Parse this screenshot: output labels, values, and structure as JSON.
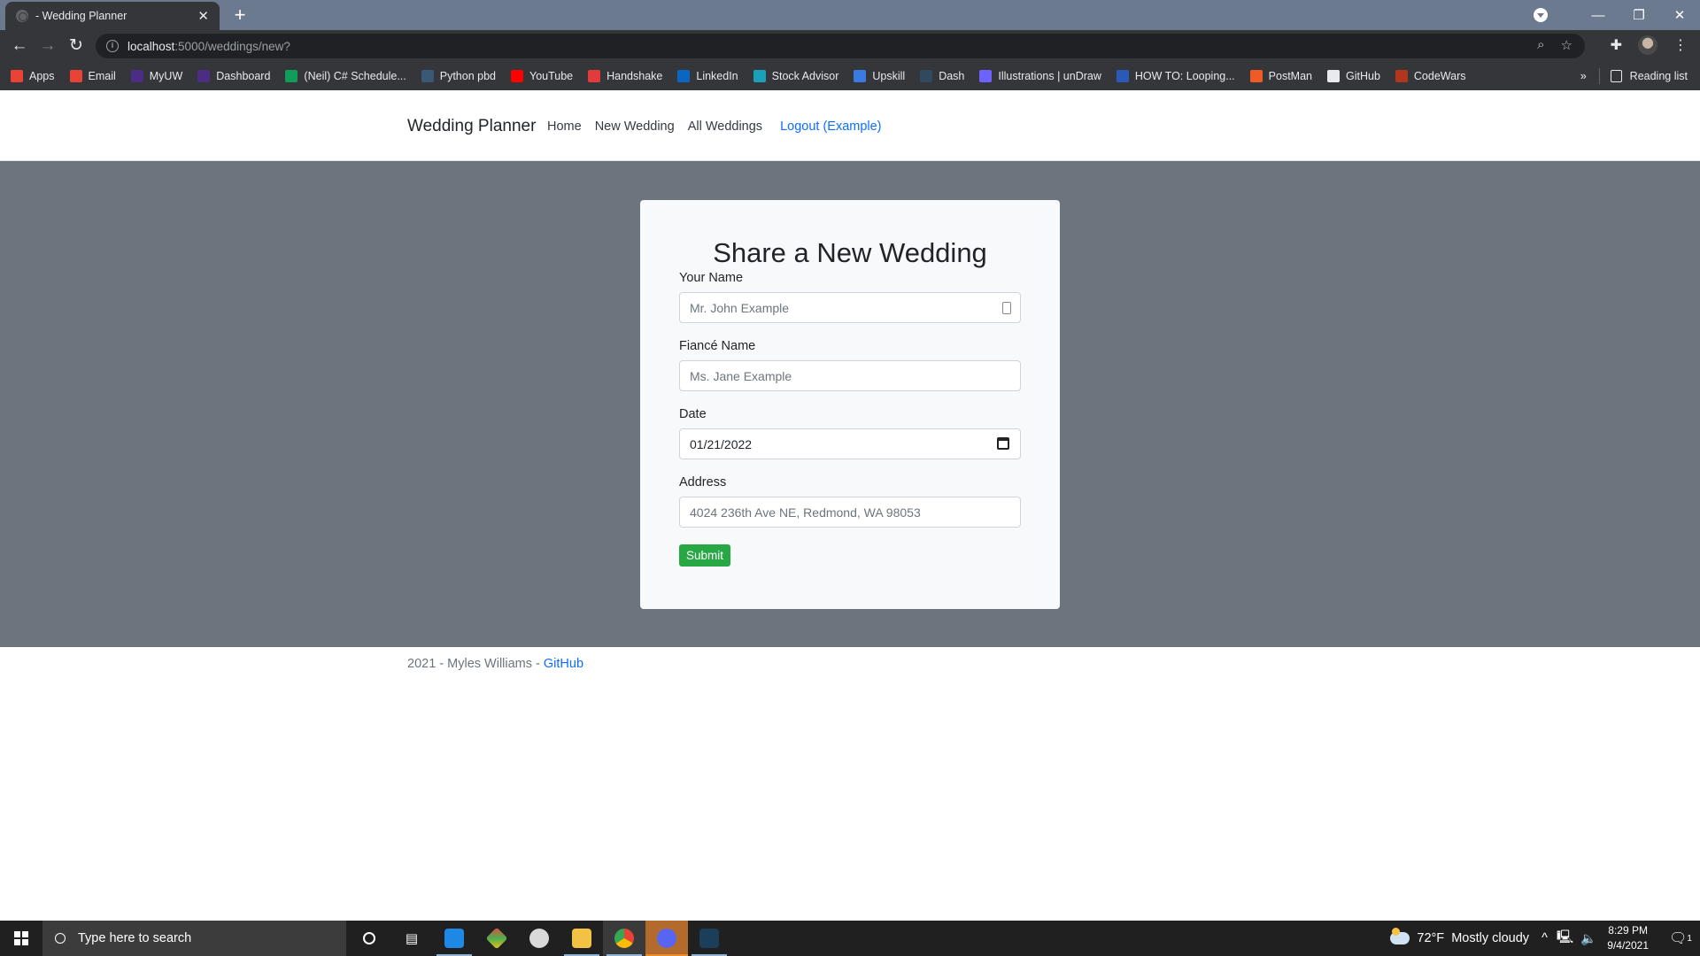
{
  "browser": {
    "tab_title": "- Wedding Planner",
    "url_host": "localhost",
    "url_path": ":5000/weddings/new?",
    "bookmarks": [
      {
        "label": "Apps",
        "icon": "apps-grid-icon",
        "color": "#ea4335"
      },
      {
        "label": "Email",
        "icon": "gmail-icon",
        "color": "#ea4335"
      },
      {
        "label": "MyUW",
        "icon": "uw-icon",
        "color": "#4b2e83"
      },
      {
        "label": "Dashboard",
        "icon": "uw-dashboard-icon",
        "color": "#4b2e83"
      },
      {
        "label": "(Neil) C# Schedule...",
        "icon": "sheets-icon",
        "color": "#0f9d58"
      },
      {
        "label": "Python pbd",
        "icon": "python-icon",
        "color": "#3b5875"
      },
      {
        "label": "YouTube",
        "icon": "youtube-icon",
        "color": "#ff0000"
      },
      {
        "label": "Handshake",
        "icon": "handshake-icon",
        "color": "#e23b3b"
      },
      {
        "label": "LinkedIn",
        "icon": "linkedin-icon",
        "color": "#0a66c2"
      },
      {
        "label": "Stock Advisor",
        "icon": "motley-fool-icon",
        "color": "#1aa0b8"
      },
      {
        "label": "Upskill",
        "icon": "upskill-icon",
        "color": "#3b7be0"
      },
      {
        "label": "Dash",
        "icon": "dash-icon",
        "color": "#2f4a5e"
      },
      {
        "label": "Illustrations | unDraw",
        "icon": "undraw-icon",
        "color": "#6c63ff"
      },
      {
        "label": "HOW TO: Looping...",
        "icon": "doc-icon",
        "color": "#2a5ab8"
      },
      {
        "label": "PostMan",
        "icon": "postman-icon",
        "color": "#ef5b25"
      },
      {
        "label": "GitHub",
        "icon": "github-icon",
        "color": "#e8eaed"
      },
      {
        "label": "CodeWars",
        "icon": "codewars-icon",
        "color": "#b1361e"
      }
    ],
    "reading_list": "Reading list",
    "more_bookmarks": "»"
  },
  "navbar": {
    "brand": "Wedding Planner",
    "links": [
      "Home",
      "New Wedding",
      "All Weddings"
    ],
    "logout": "Logout (Example)"
  },
  "form": {
    "title": "Share a New Wedding",
    "fields": [
      {
        "label": "Your Name",
        "value": "",
        "placeholder": "Mr. John Example",
        "type": "text"
      },
      {
        "label": "Fiancé Name",
        "value": "",
        "placeholder": "Ms. Jane Example",
        "type": "text"
      },
      {
        "label": "Date",
        "value": "01/21/2022",
        "placeholder": "",
        "type": "date"
      },
      {
        "label": "Address",
        "value": "",
        "placeholder": "4024 236th Ave NE, Redmond, WA 98053",
        "type": "text"
      }
    ],
    "submit": "Submit",
    "submit_color": "#28a745"
  },
  "footer": {
    "text": "2021 - Myles Williams - ",
    "link": "GitHub"
  },
  "taskbar": {
    "search_placeholder": "Type here to search",
    "weather": "72°F  Mostly cloudy",
    "time": "8:29 PM",
    "date": "9/4/2021",
    "notifications": "1"
  },
  "colors": {
    "main_bg": "#6c757d",
    "card_bg": "#f8f9fa",
    "link": "#0d6efd"
  }
}
